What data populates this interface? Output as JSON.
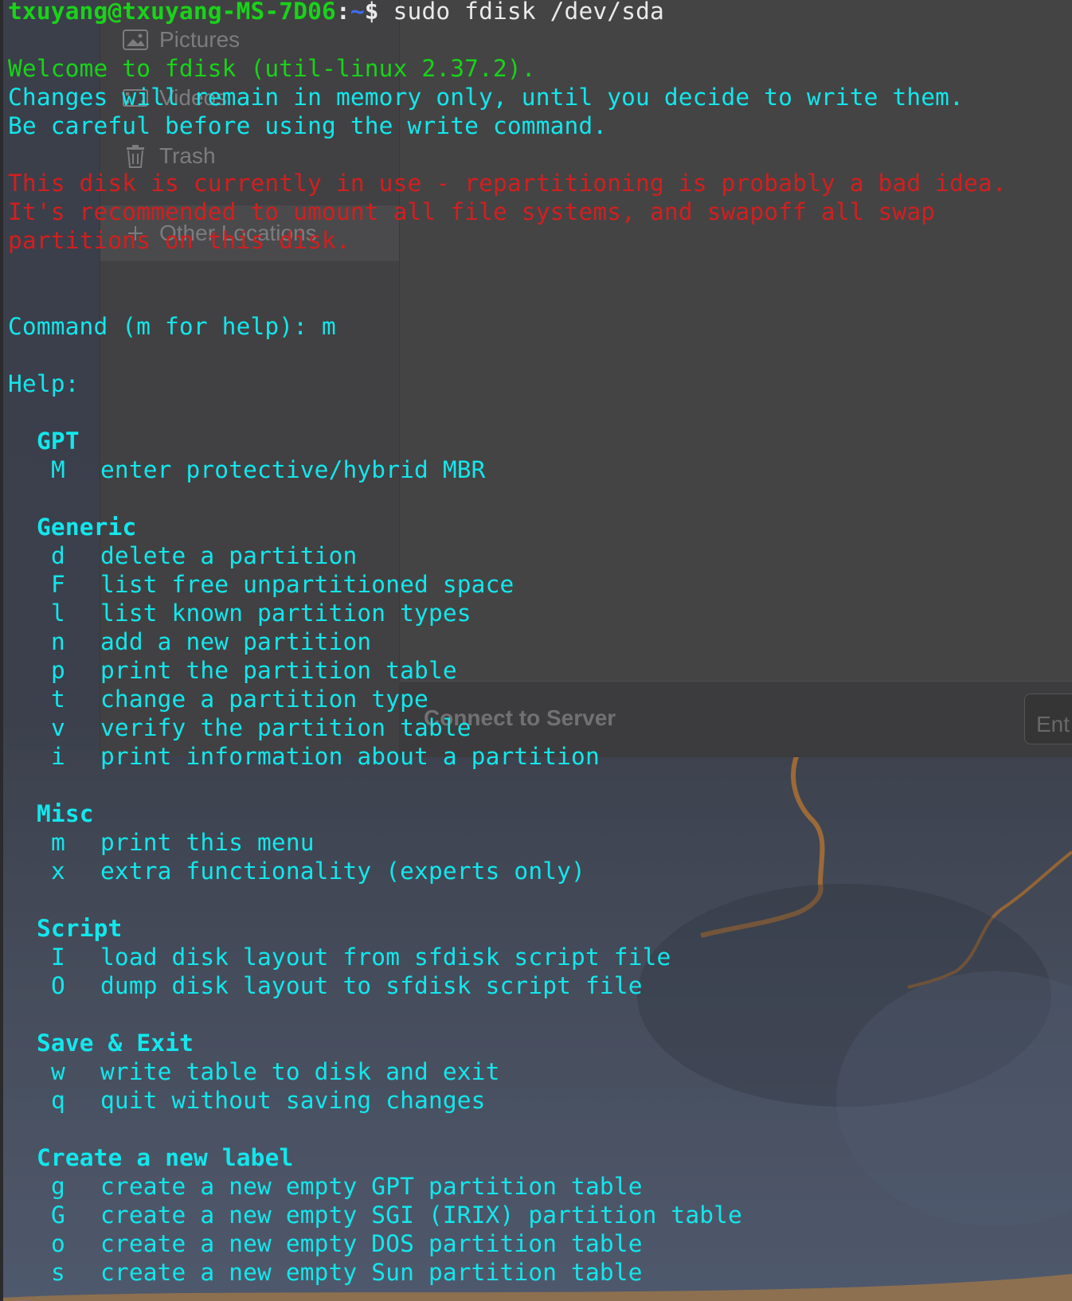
{
  "file_manager": {
    "sidebar": [
      {
        "label": "Pictures",
        "icon": "pictures-icon"
      },
      {
        "label": "Videos",
        "icon": "videos-icon"
      },
      {
        "label": "Trash",
        "icon": "trash-icon"
      },
      {
        "label": "Other Locations",
        "icon": "plus-icon"
      }
    ],
    "connect_label": "Connect to Server",
    "connect_placeholder": "Ent"
  },
  "terminal": {
    "prompt_user": "txuyang@txuyang-MS-7D06",
    "prompt_sep": ":",
    "prompt_path": "~",
    "prompt_symbol": "$",
    "command": " sudo fdisk /dev/sda",
    "welcome": "Welcome to fdisk (util-linux 2.37.2).",
    "changes": "Changes will remain in memory only, until you decide to write them.",
    "careful": "Be careful before using the write command.",
    "warn1": "This disk is currently in use - repartitioning is probably a bad idea.",
    "warn2": "It's recommended to umount all file systems, and swapoff all swap",
    "warn3": "partitions on this disk.",
    "cmd_prompt": "Command (m for help): m",
    "help": "Help:",
    "sections": [
      {
        "title": "GPT",
        "items": [
          {
            "key": "M",
            "desc": "enter protective/hybrid MBR"
          }
        ]
      },
      {
        "title": "Generic",
        "items": [
          {
            "key": "d",
            "desc": "delete a partition"
          },
          {
            "key": "F",
            "desc": "list free unpartitioned space"
          },
          {
            "key": "l",
            "desc": "list known partition types"
          },
          {
            "key": "n",
            "desc": "add a new partition"
          },
          {
            "key": "p",
            "desc": "print the partition table"
          },
          {
            "key": "t",
            "desc": "change a partition type"
          },
          {
            "key": "v",
            "desc": "verify the partition table"
          },
          {
            "key": "i",
            "desc": "print information about a partition"
          }
        ]
      },
      {
        "title": "Misc",
        "items": [
          {
            "key": "m",
            "desc": "print this menu"
          },
          {
            "key": "x",
            "desc": "extra functionality (experts only)"
          }
        ]
      },
      {
        "title": "Script",
        "items": [
          {
            "key": "I",
            "desc": "load disk layout from sfdisk script file"
          },
          {
            "key": "O",
            "desc": "dump disk layout to sfdisk script file"
          }
        ]
      },
      {
        "title": "Save & Exit",
        "items": [
          {
            "key": "w",
            "desc": "write table to disk and exit"
          },
          {
            "key": "q",
            "desc": "quit without saving changes"
          }
        ]
      },
      {
        "title": "Create a new label",
        "items": [
          {
            "key": "g",
            "desc": "create a new empty GPT partition table"
          },
          {
            "key": "G",
            "desc": "create a new empty SGI (IRIX) partition table"
          },
          {
            "key": "o",
            "desc": "create a new empty DOS partition table"
          },
          {
            "key": "s",
            "desc": "create a new empty Sun partition table"
          }
        ]
      }
    ]
  },
  "colors": {
    "prompt_green": "#19d319",
    "text_cyan": "#12e7ec",
    "warning_red": "#d41e1e",
    "path_blue": "#3d6df2"
  }
}
